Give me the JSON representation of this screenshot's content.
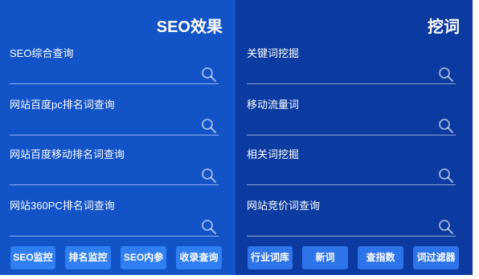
{
  "seo_panel": {
    "title": "SEO效果",
    "fields": [
      {
        "label": "SEO综合查询",
        "value": ""
      },
      {
        "label": "网站百度pc排名词查询",
        "value": ""
      },
      {
        "label": "网站百度移动排名词查询",
        "value": ""
      },
      {
        "label": "网站360PC排名词查询",
        "value": ""
      }
    ],
    "buttons": [
      "SEO监控",
      "排名监控",
      "SEO内参",
      "收录查询"
    ]
  },
  "keyword_panel": {
    "title": "挖词",
    "fields": [
      {
        "label": "关键词挖掘",
        "value": ""
      },
      {
        "label": "移动流量词",
        "value": ""
      },
      {
        "label": "相关词挖掘",
        "value": ""
      },
      {
        "label": "网站竞价词查询",
        "value": ""
      }
    ],
    "buttons": [
      "行业词库",
      "新词",
      "查指数",
      "词过滤器"
    ]
  },
  "colors": {
    "seo_panel_bg": "#1253c8",
    "keyword_panel_bg": "#0b3aa1",
    "button_bg": "#2f7ef2",
    "text": "#ffffff"
  },
  "icons": {
    "search": "search-icon"
  }
}
